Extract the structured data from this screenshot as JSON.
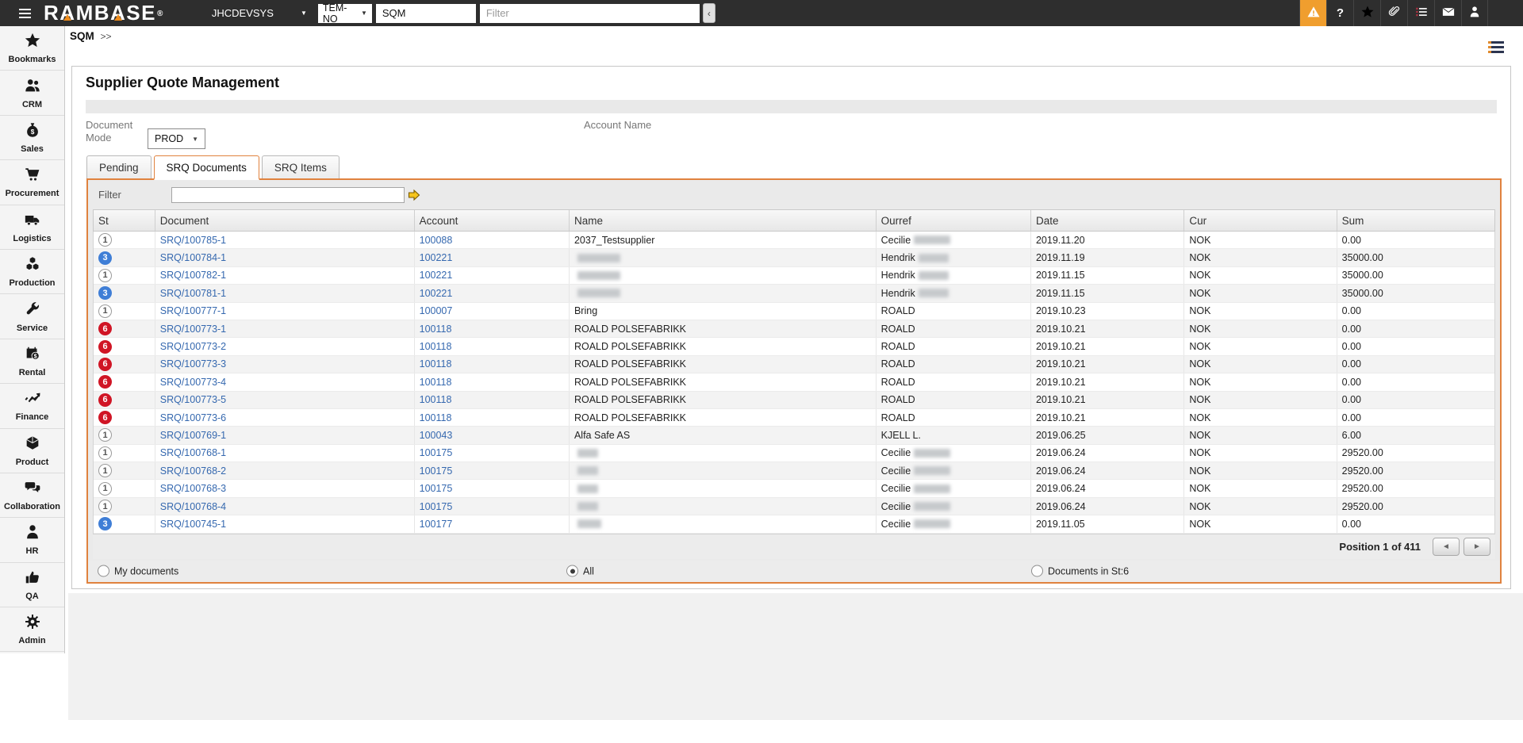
{
  "topbar": {
    "logo_text": "RAMBASE",
    "logo_reg": "®",
    "account": "JHCDEVSYS",
    "account_caret": "▼",
    "system": "TEM-NO",
    "system_caret": "▼",
    "program_value": "SQM",
    "filter_placeholder": "Filter",
    "collapse_label": "‹",
    "icons": [
      {
        "name": "warning-icon",
        "active": true
      },
      {
        "name": "help-icon",
        "active": false,
        "glyph": "?"
      },
      {
        "name": "star-icon",
        "active": false
      },
      {
        "name": "paperclip-icon",
        "active": false
      },
      {
        "name": "list-icon",
        "active": false
      },
      {
        "name": "mail-icon",
        "active": false
      },
      {
        "name": "user-icon",
        "active": false
      }
    ]
  },
  "sidebar": {
    "items": [
      {
        "label": "Bookmarks",
        "icon": "star-icon"
      },
      {
        "label": "CRM",
        "icon": "people-icon"
      },
      {
        "label": "Sales",
        "icon": "money-bag-icon"
      },
      {
        "label": "Procurement",
        "icon": "cart-icon"
      },
      {
        "label": "Logistics",
        "icon": "truck-icon"
      },
      {
        "label": "Production",
        "icon": "cubes-icon"
      },
      {
        "label": "Service",
        "icon": "wrench-icon"
      },
      {
        "label": "Rental",
        "icon": "calendar-dollar-icon"
      },
      {
        "label": "Finance",
        "icon": "chart-icon"
      },
      {
        "label": "Product",
        "icon": "cube-icon"
      },
      {
        "label": "Collaboration",
        "icon": "chat-icon"
      },
      {
        "label": "HR",
        "icon": "person-icon"
      },
      {
        "label": "QA",
        "icon": "thumbs-up-icon"
      },
      {
        "label": "Admin",
        "icon": "gear-icon"
      }
    ]
  },
  "breadcrumb": {
    "program": "SQM",
    "arrows": ">>"
  },
  "page": {
    "title": "Supplier Quote Management"
  },
  "form": {
    "document_mode_label": "Document Mode",
    "document_mode_value": "PROD",
    "account_name_label": "Account Name"
  },
  "tabs": [
    {
      "label": "Pending",
      "active": false
    },
    {
      "label": "SRQ Documents",
      "active": true
    },
    {
      "label": "SRQ Items",
      "active": false
    }
  ],
  "filter_panel": {
    "label": "Filter",
    "value": ""
  },
  "table": {
    "columns": [
      {
        "key": "st",
        "label": "St"
      },
      {
        "key": "document",
        "label": "Document"
      },
      {
        "key": "account",
        "label": "Account"
      },
      {
        "key": "name",
        "label": "Name"
      },
      {
        "key": "ourref",
        "label": "Ourref"
      },
      {
        "key": "date",
        "label": "Date"
      },
      {
        "key": "cur",
        "label": "Cur"
      },
      {
        "key": "sum",
        "label": "Sum"
      }
    ],
    "rows": [
      {
        "st": "1",
        "st_style": "open",
        "document": "SRQ/100785-1",
        "account": "100088",
        "name": "2037_Testsupplier",
        "name_blur": 0,
        "ourref": "Cecilie",
        "ourref_blur": 46,
        "date": "2019.11.20",
        "cur": "NOK",
        "sum": "0.00"
      },
      {
        "st": "3",
        "st_style": "blue",
        "document": "SRQ/100784-1",
        "account": "100221",
        "name": "",
        "name_blur": 54,
        "ourref": "Hendrik",
        "ourref_blur": 38,
        "date": "2019.11.19",
        "cur": "NOK",
        "sum": "35000.00"
      },
      {
        "st": "1",
        "st_style": "open",
        "document": "SRQ/100782-1",
        "account": "100221",
        "name": "",
        "name_blur": 54,
        "ourref": "Hendrik",
        "ourref_blur": 38,
        "date": "2019.11.15",
        "cur": "NOK",
        "sum": "35000.00"
      },
      {
        "st": "3",
        "st_style": "blue",
        "document": "SRQ/100781-1",
        "account": "100221",
        "name": "",
        "name_blur": 54,
        "ourref": "Hendrik",
        "ourref_blur": 38,
        "date": "2019.11.15",
        "cur": "NOK",
        "sum": "35000.00"
      },
      {
        "st": "1",
        "st_style": "open",
        "document": "SRQ/100777-1",
        "account": "100007",
        "name": "Bring",
        "name_blur": 0,
        "ourref": "ROALD",
        "ourref_blur": 0,
        "date": "2019.10.23",
        "cur": "NOK",
        "sum": "0.00"
      },
      {
        "st": "6",
        "st_style": "red",
        "document": "SRQ/100773-1",
        "account": "100118",
        "name": "ROALD POLSEFABRIKK",
        "name_blur": 0,
        "ourref": "ROALD",
        "ourref_blur": 0,
        "date": "2019.10.21",
        "cur": "NOK",
        "sum": "0.00"
      },
      {
        "st": "6",
        "st_style": "red",
        "document": "SRQ/100773-2",
        "account": "100118",
        "name": "ROALD POLSEFABRIKK",
        "name_blur": 0,
        "ourref": "ROALD",
        "ourref_blur": 0,
        "date": "2019.10.21",
        "cur": "NOK",
        "sum": "0.00"
      },
      {
        "st": "6",
        "st_style": "red",
        "document": "SRQ/100773-3",
        "account": "100118",
        "name": "ROALD POLSEFABRIKK",
        "name_blur": 0,
        "ourref": "ROALD",
        "ourref_blur": 0,
        "date": "2019.10.21",
        "cur": "NOK",
        "sum": "0.00"
      },
      {
        "st": "6",
        "st_style": "red",
        "document": "SRQ/100773-4",
        "account": "100118",
        "name": "ROALD POLSEFABRIKK",
        "name_blur": 0,
        "ourref": "ROALD",
        "ourref_blur": 0,
        "date": "2019.10.21",
        "cur": "NOK",
        "sum": "0.00"
      },
      {
        "st": "6",
        "st_style": "red",
        "document": "SRQ/100773-5",
        "account": "100118",
        "name": "ROALD POLSEFABRIKK",
        "name_blur": 0,
        "ourref": "ROALD",
        "ourref_blur": 0,
        "date": "2019.10.21",
        "cur": "NOK",
        "sum": "0.00"
      },
      {
        "st": "6",
        "st_style": "red",
        "document": "SRQ/100773-6",
        "account": "100118",
        "name": "ROALD POLSEFABRIKK",
        "name_blur": 0,
        "ourref": "ROALD",
        "ourref_blur": 0,
        "date": "2019.10.21",
        "cur": "NOK",
        "sum": "0.00"
      },
      {
        "st": "1",
        "st_style": "open",
        "document": "SRQ/100769-1",
        "account": "100043",
        "name": "Alfa Safe AS",
        "name_blur": 0,
        "ourref": "KJELL L.",
        "ourref_blur": 0,
        "date": "2019.06.25",
        "cur": "NOK",
        "sum": "6.00"
      },
      {
        "st": "1",
        "st_style": "open",
        "document": "SRQ/100768-1",
        "account": "100175",
        "name": "",
        "name_blur": 26,
        "ourref": "Cecilie",
        "ourref_blur": 46,
        "date": "2019.06.24",
        "cur": "NOK",
        "sum": "29520.00"
      },
      {
        "st": "1",
        "st_style": "open",
        "document": "SRQ/100768-2",
        "account": "100175",
        "name": "",
        "name_blur": 26,
        "ourref": "Cecilie",
        "ourref_blur": 46,
        "date": "2019.06.24",
        "cur": "NOK",
        "sum": "29520.00"
      },
      {
        "st": "1",
        "st_style": "open",
        "document": "SRQ/100768-3",
        "account": "100175",
        "name": "",
        "name_blur": 26,
        "ourref": "Cecilie",
        "ourref_blur": 46,
        "date": "2019.06.24",
        "cur": "NOK",
        "sum": "29520.00"
      },
      {
        "st": "1",
        "st_style": "open",
        "document": "SRQ/100768-4",
        "account": "100175",
        "name": "",
        "name_blur": 26,
        "ourref": "Cecilie",
        "ourref_blur": 46,
        "date": "2019.06.24",
        "cur": "NOK",
        "sum": "29520.00"
      },
      {
        "st": "3",
        "st_style": "blue",
        "document": "SRQ/100745-1",
        "account": "100177",
        "name": "",
        "name_blur": 30,
        "ourref": "Cecilie",
        "ourref_blur": 46,
        "date": "2019.11.05",
        "cur": "NOK",
        "sum": "0.00"
      }
    ]
  },
  "pagination": {
    "text": "Position 1 of 411",
    "prev": "◄",
    "next": "►"
  },
  "footer_options": [
    {
      "label": "My documents",
      "selected": false
    },
    {
      "label": "All",
      "selected": true
    },
    {
      "label": "Documents in St:6",
      "selected": false
    }
  ],
  "colors": {
    "topbar_bg": "#2e2e2e",
    "brand_orange": "#ee8c1c",
    "alert_orange": "#f09e2e",
    "panel_border_orange": "#e0823e",
    "status_blue": "#3f7ed6",
    "status_red": "#d01525",
    "link_blue": "#3568af"
  }
}
